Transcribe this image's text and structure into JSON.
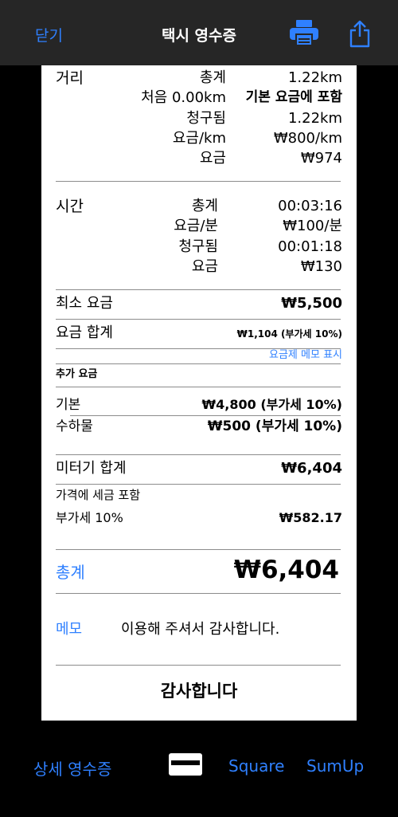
{
  "topbar": {
    "close_label": "닫기",
    "title": "택시 영수증",
    "print_icon": "printer-icon",
    "share_icon": "share-icon"
  },
  "receipt": {
    "distance": {
      "label": "거리",
      "rows": [
        {
          "label": "총계",
          "value": "1.22km"
        },
        {
          "label": "처음 0.00km",
          "value": "기본 요금에 포함"
        },
        {
          "label": "청구됨",
          "value": "1.22km"
        },
        {
          "label": "요금/km",
          "value": "₩800/km"
        },
        {
          "label": "요금",
          "value": "₩974"
        }
      ]
    },
    "time": {
      "label": "시간",
      "rows": [
        {
          "label": "총계",
          "value": "00:03:16"
        },
        {
          "label": "요금/분",
          "value": "₩100/분"
        },
        {
          "label": "청구됨",
          "value": "00:01:18"
        },
        {
          "label": "요금",
          "value": "₩130"
        }
      ]
    },
    "minimum_fare": {
      "label": "최소 요금",
      "value": "₩5,500"
    },
    "fare_total": {
      "label": "요금 합계",
      "value": "₩1,104 (부가세 10%)"
    },
    "show_rate_memo_link": "요금제 메모 표시",
    "extras": {
      "label": "추가 요금",
      "base": {
        "label": "기본",
        "value": "₩4,800 (부가세 10%)"
      },
      "luggage": {
        "label": "수하물",
        "value": "₩500 (부가세 10%)"
      }
    },
    "meter_total": {
      "label": "미터기 합계",
      "value": "₩6,404"
    },
    "tax_included_label": "가격에 세금 포함",
    "vat": {
      "label": "부가세 10%",
      "value": "₩582.17"
    },
    "grand_total": {
      "label": "총계",
      "value": "₩6,404"
    },
    "memo": {
      "label": "메모",
      "text": "이용해 주셔서 감사합니다."
    },
    "thanks": "감사합니다"
  },
  "bottombar": {
    "detail_receipt": "상세 영수증",
    "card_icon": "credit-card-icon",
    "square": "Square",
    "sumup": "SumUp"
  },
  "colors": {
    "accent": "#2f80ff",
    "topbar": "#262626",
    "background": "#000000"
  }
}
